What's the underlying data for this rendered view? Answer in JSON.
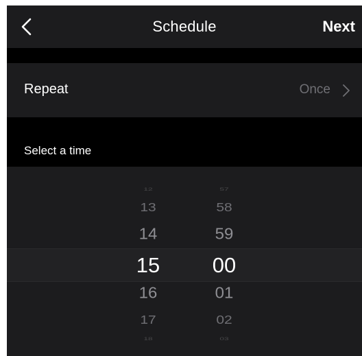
{
  "header": {
    "title": "Schedule",
    "next_label": "Next",
    "back_icon": "chevron-left-icon"
  },
  "repeat": {
    "label": "Repeat",
    "value": "Once",
    "chevron_icon": "chevron-right-icon"
  },
  "time_section": {
    "title": "Select a time"
  },
  "picker": {
    "hours": [
      "12",
      "13",
      "14",
      "15",
      "16",
      "17",
      "18"
    ],
    "minutes": [
      "57",
      "58",
      "59",
      "00",
      "01",
      "02",
      "03"
    ],
    "selected_hour": "15",
    "selected_minute": "00"
  },
  "colors": {
    "background": "#000000",
    "surface": "#1c1c1e",
    "text_primary": "#ffffff",
    "text_secondary": "#8e8e93"
  }
}
